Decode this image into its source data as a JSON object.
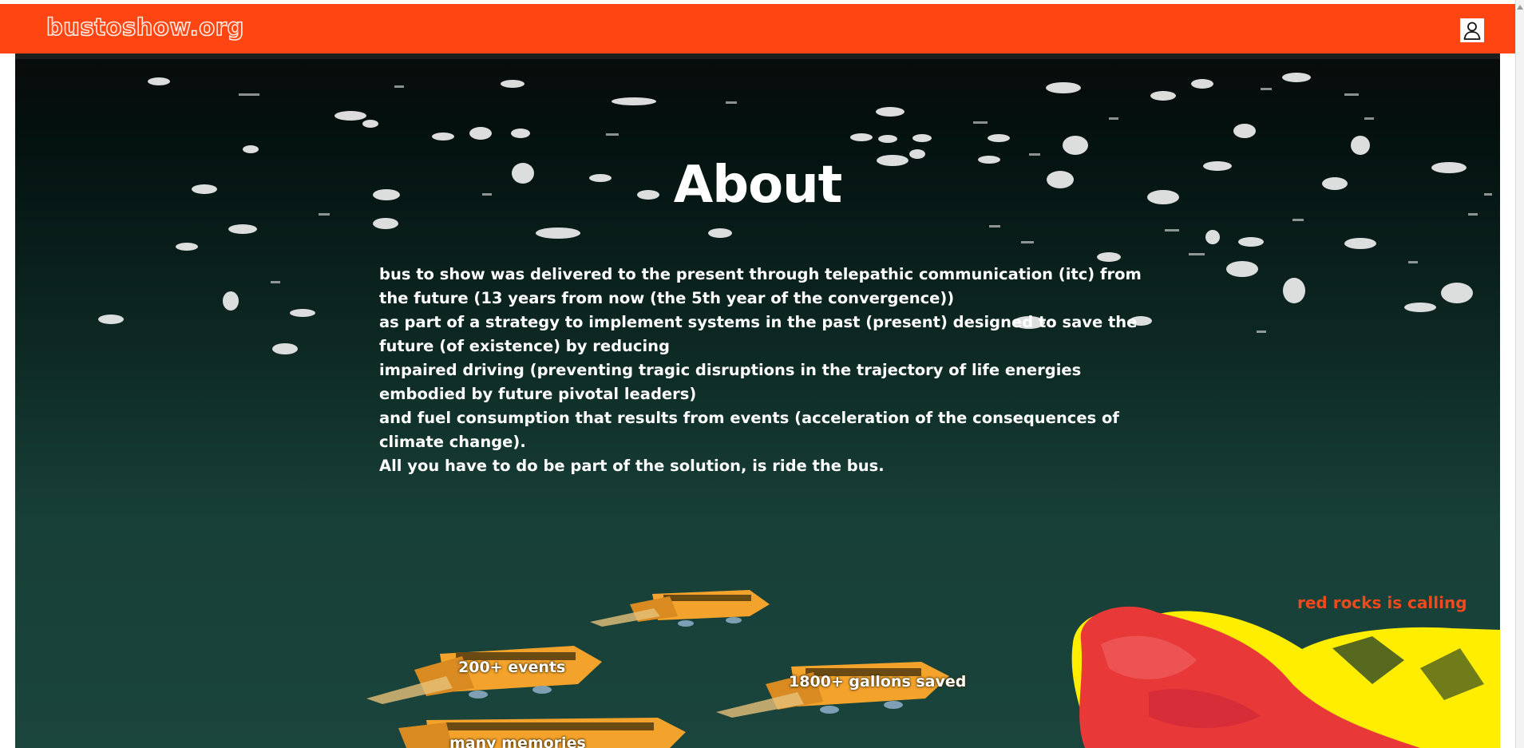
{
  "header": {
    "site_name": "bustoshow.org",
    "user_icon": "user-icon",
    "brand_color": "#fe4512"
  },
  "about": {
    "title": "About",
    "paragraphs": [
      "bus to show was delivered to the present through telepathic communication (itc) from the future (13 years from now (the 5th year of the convergence))",
      "as part of a strategy to implement systems in the past (present) designed to save the future (of existence) by reducing",
      "impaired driving (preventing tragic disruptions in the trajectory of life energies embodied by future pivotal leaders)",
      "and fuel consumption that results from events (acceleration of the consequences of climate change).",
      "All you have to do be part of the solution, is ride the bus."
    ]
  },
  "promo": {
    "label": "red rocks is calling",
    "color": "#f04a1c"
  },
  "stats": [
    {
      "label": "200+ events"
    },
    {
      "label": "1800+ gallons saved"
    },
    {
      "label": "many memories"
    }
  ]
}
